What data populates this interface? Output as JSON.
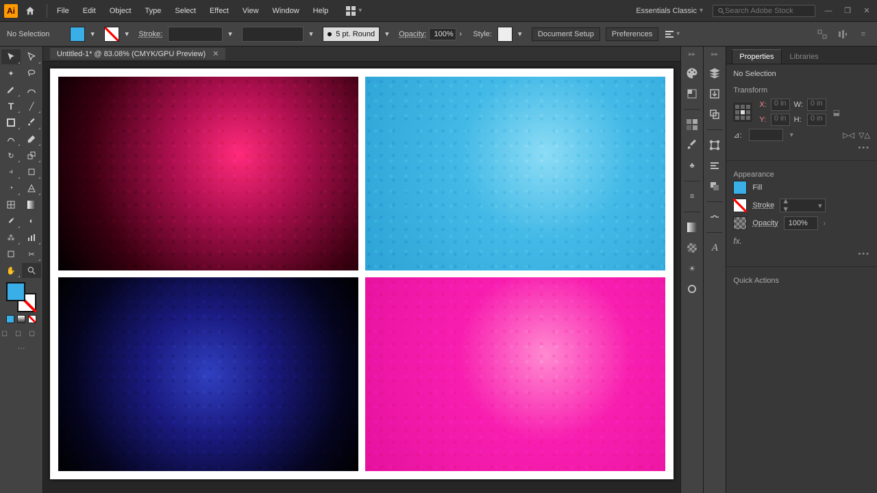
{
  "menubar": {
    "app_abbr": "Ai",
    "items": [
      "File",
      "Edit",
      "Object",
      "Type",
      "Select",
      "Effect",
      "View",
      "Window",
      "Help"
    ],
    "workspace": "Essentials Classic",
    "search_placeholder": "Search Adobe Stock"
  },
  "controlbar": {
    "selection_state": "No Selection",
    "stroke_label": "Stroke:",
    "brush_label": "5 pt. Round",
    "opacity_label": "Opacity:",
    "opacity_value": "100%",
    "style_label": "Style:",
    "doc_setup": "Document Setup",
    "prefs": "Preferences"
  },
  "document": {
    "tab_title": "Untitled-1* @ 83.08% (CMYK/GPU Preview)"
  },
  "right_panel": {
    "tab_props": "Properties",
    "tab_libs": "Libraries",
    "no_selection": "No Selection",
    "transform": "Transform",
    "x_lbl": "X:",
    "y_lbl": "Y:",
    "w_lbl": "W:",
    "h_lbl": "H:",
    "x_val": "0 in",
    "y_val": "0 in",
    "w_val": "0 in",
    "h_val": "0 in",
    "angle_sym": "⊿:",
    "appearance": "Appearance",
    "fill_lbl": "Fill",
    "stroke_lbl": "Stroke",
    "opacity_lbl": "Opacity",
    "opacity_val": "100%",
    "fx_lbl": "fx.",
    "quick_actions": "Quick Actions"
  },
  "colors": {
    "fill": "#3aaee6"
  }
}
